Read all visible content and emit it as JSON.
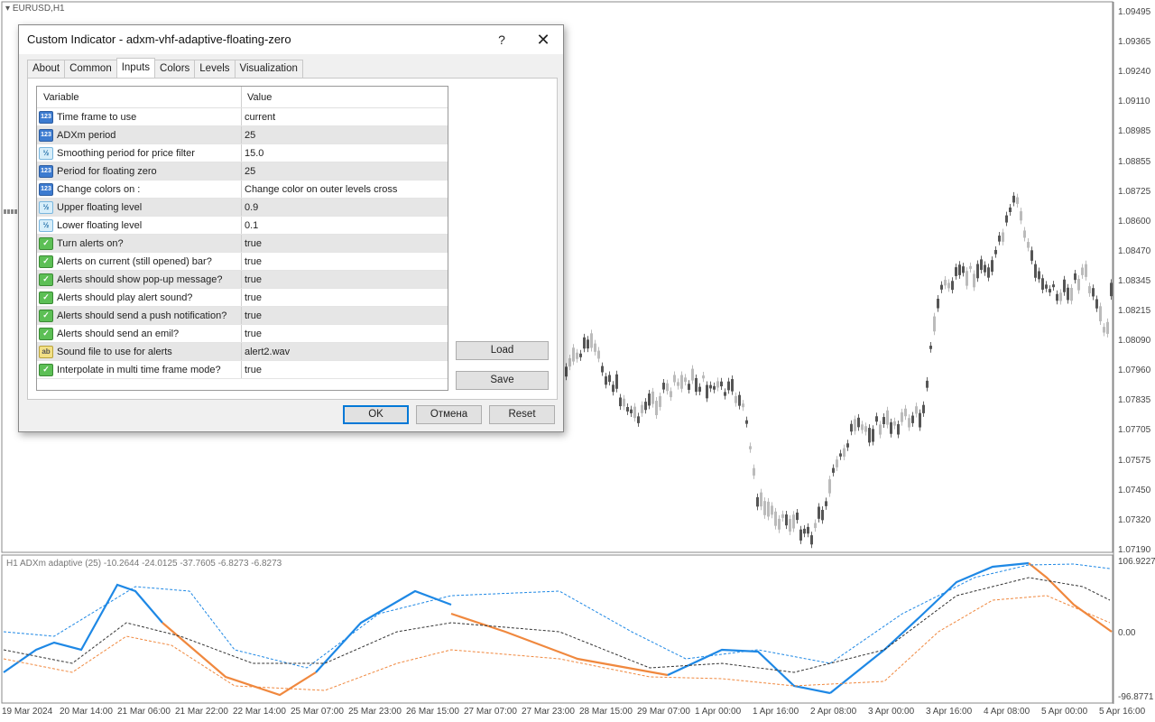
{
  "chart": {
    "symbol": "EURUSD,H1",
    "price_labels": [
      "1.09495",
      "1.09365",
      "1.09240",
      "1.09110",
      "1.08985",
      "1.08855",
      "1.08725",
      "1.08600",
      "1.08470",
      "1.08345",
      "1.08215",
      "1.08090",
      "1.07960",
      "1.07835",
      "1.07705",
      "1.07575",
      "1.07450",
      "1.07320",
      "1.07190"
    ],
    "time_labels": [
      "19 Mar 2024",
      "20 Mar 14:00",
      "21 Mar 06:00",
      "21 Mar 22:00",
      "22 Mar 14:00",
      "25 Mar 07:00",
      "25 Mar 23:00",
      "26 Mar 15:00",
      "27 Mar 07:00",
      "27 Mar 23:00",
      "28 Mar 15:00",
      "29 Mar 07:00",
      "1 Apr 00:00",
      "1 Apr 16:00",
      "2 Apr 08:00",
      "3 Apr 00:00",
      "3 Apr 16:00",
      "4 Apr 08:00",
      "5 Apr 00:00",
      "5 Apr 16:00"
    ]
  },
  "indicator": {
    "label": "H1 ADXm adaptive (25) -10.2644 -24.0125 -37.7605 -6.8273 -6.8273",
    "scale": [
      "106.9227",
      "0.00",
      "-96.8771"
    ],
    "colors": {
      "up": "#1e88e5",
      "down": "#f0883e",
      "neutral": "#a0a0a0",
      "mid": "#333333"
    }
  },
  "dialog": {
    "title": "Custom Indicator - adxm-vhf-adaptive-floating-zero",
    "help": "?",
    "close": "✕",
    "tabs": [
      "About",
      "Common",
      "Inputs",
      "Colors",
      "Levels",
      "Visualization"
    ],
    "active_tab": "Inputs",
    "grid_header": {
      "variable": "Variable",
      "value": "Value"
    },
    "rows": [
      {
        "type": "int",
        "icon": "123",
        "variable": "Time frame to use",
        "value": "current"
      },
      {
        "type": "int",
        "icon": "123",
        "variable": "ADXm period",
        "value": "25"
      },
      {
        "type": "dbl",
        "icon": "½",
        "variable": "Smoothing period for price filter",
        "value": "15.0"
      },
      {
        "type": "int",
        "icon": "123",
        "variable": "Period for floating zero",
        "value": "25"
      },
      {
        "type": "int",
        "icon": "123",
        "variable": "Change colors on :",
        "value": "Change color on outer levels cross"
      },
      {
        "type": "dbl",
        "icon": "½",
        "variable": "Upper floating level",
        "value": "0.9"
      },
      {
        "type": "dbl",
        "icon": "½",
        "variable": "Lower floating level",
        "value": "0.1"
      },
      {
        "type": "bool",
        "icon": "✓",
        "variable": "Turn alerts on?",
        "value": "true"
      },
      {
        "type": "bool",
        "icon": "✓",
        "variable": "Alerts on current (still opened) bar?",
        "value": "true"
      },
      {
        "type": "bool",
        "icon": "✓",
        "variable": "Alerts should show pop-up message?",
        "value": "true"
      },
      {
        "type": "bool",
        "icon": "✓",
        "variable": "Alerts should play alert sound?",
        "value": "true"
      },
      {
        "type": "bool",
        "icon": "✓",
        "variable": "Alerts should send a push notification?",
        "value": "true"
      },
      {
        "type": "bool",
        "icon": "✓",
        "variable": "Alerts should send an emil?",
        "value": "true"
      },
      {
        "type": "str",
        "icon": "ab",
        "variable": "Sound file to use for alerts",
        "value": "alert2.wav"
      },
      {
        "type": "bool",
        "icon": "✓",
        "variable": "Interpolate in multi time frame mode?",
        "value": "true"
      }
    ],
    "buttons": {
      "load": "Load",
      "save": "Save",
      "ok": "OK",
      "cancel": "Отмена",
      "reset": "Reset"
    }
  }
}
